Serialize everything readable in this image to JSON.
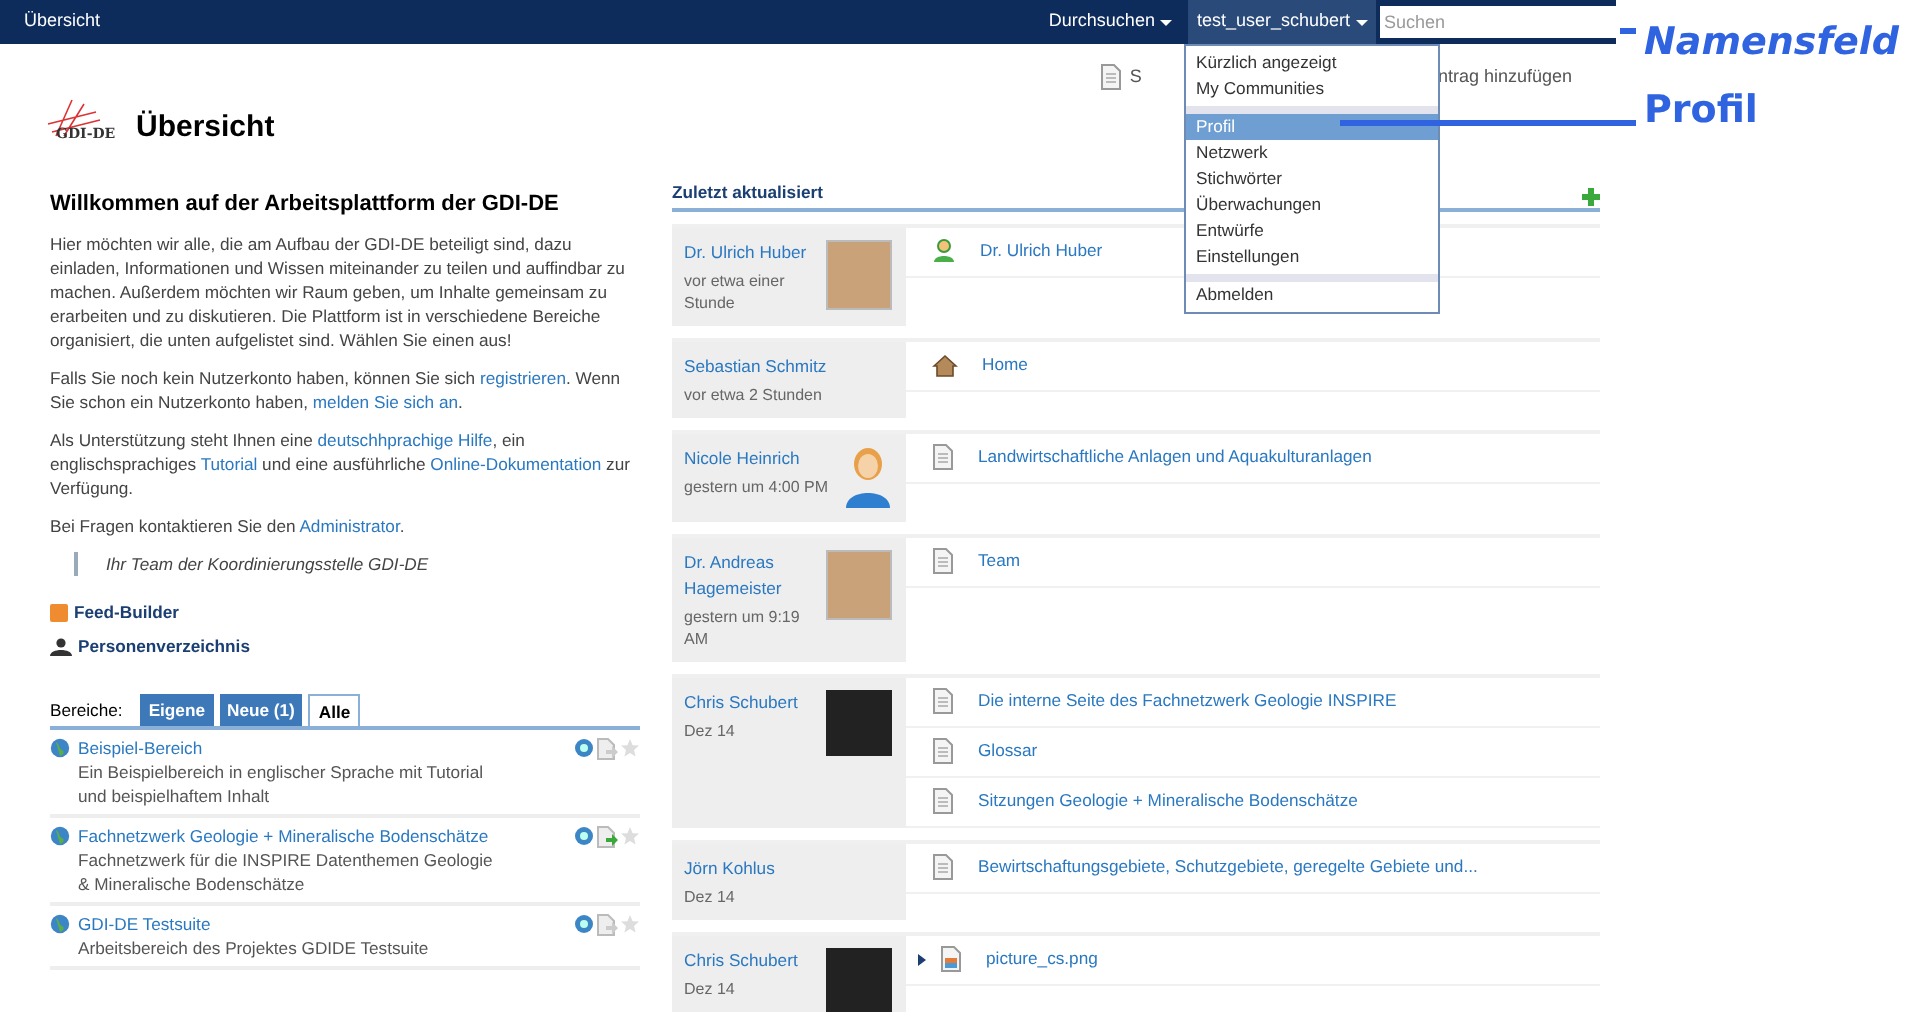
{
  "topbar": {
    "title": "Übersicht",
    "browse": "Durchsuchen",
    "user": "test_user_schubert",
    "search": {
      "placeholder": "Suchen"
    }
  },
  "user_menu": {
    "items": [
      {
        "label": "Kürzlich angezeigt",
        "selected": false,
        "divider_before": false
      },
      {
        "label": "My Communities",
        "selected": false,
        "divider_before": false
      },
      {
        "label": "Profil",
        "selected": true,
        "divider_before": true
      },
      {
        "label": "Netzwerk",
        "selected": false,
        "divider_before": false
      },
      {
        "label": "Stichwörter",
        "selected": false,
        "divider_before": false
      },
      {
        "label": "Überwachungen",
        "selected": false,
        "divider_before": false
      },
      {
        "label": "Entwürfe",
        "selected": false,
        "divider_before": false
      },
      {
        "label": "Einstellungen",
        "selected": false,
        "divider_before": false
      },
      {
        "label": "Abmelden",
        "selected": false,
        "divider_before": true
      }
    ]
  },
  "header": {
    "logo_text": "GDI-DE",
    "title": "Übersicht",
    "action_left": "S",
    "action_right": "ntrag hinzufügen"
  },
  "welcome": {
    "heading": "Willkommen auf der Arbeitsplattform der GDI-DE",
    "paragraphs": [
      [
        {
          "kind": "text",
          "text": "Hier möchten wir alle, die am Aufbau der GDI-DE beteiligt sind, dazu einladen, Informationen und Wissen miteinander zu teilen und auffindbar zu machen. Außerdem möchten wir Raum geben, um Inhalte gemeinsam zu erarbeiten und zu diskutieren. Die Plattform ist in verschiedene Bereiche organisiert, die unten aufgelistet sind. Wählen Sie einen aus!"
        }
      ],
      [
        {
          "kind": "text",
          "text": "Falls Sie noch kein Nutzerkonto haben, können Sie sich "
        },
        {
          "kind": "link",
          "text": "registrieren"
        },
        {
          "kind": "text",
          "text": ". Wenn Sie schon ein Nutzerkonto haben, "
        },
        {
          "kind": "link",
          "text": "melden Sie sich an"
        },
        {
          "kind": "text",
          "text": "."
        }
      ],
      [
        {
          "kind": "text",
          "text": "Als Unterstützung steht Ihnen eine "
        },
        {
          "kind": "link",
          "text": "deutschhprachige Hilfe"
        },
        {
          "kind": "text",
          "text": ", ein englischsprachiges "
        },
        {
          "kind": "link",
          "text": "Tutorial"
        },
        {
          "kind": "text",
          "text": " und eine ausführliche "
        },
        {
          "kind": "link",
          "text": "Online-Dokumentation"
        },
        {
          "kind": "text",
          "text": " zur Verfügung."
        }
      ],
      [
        {
          "kind": "text",
          "text": "Bei Fragen kontaktieren Sie den "
        },
        {
          "kind": "link",
          "text": "Administrator"
        },
        {
          "kind": "text",
          "text": "."
        }
      ]
    ],
    "signature": "Ihr Team der Koordinierungsstelle GDI-DE"
  },
  "links": [
    {
      "kind": "feed",
      "label": "Feed-Builder"
    },
    {
      "kind": "people",
      "label": "Personenverzeichnis"
    }
  ],
  "areas": {
    "label": "Bereiche:",
    "tabs": [
      {
        "label": "Eigene",
        "selected": false
      },
      {
        "label": "Neue (1)",
        "selected": false
      },
      {
        "label": "Alle",
        "selected": true
      }
    ],
    "items": [
      {
        "title": "Beispiel-Bereich",
        "description": "Ein Beispielbereich in englischer Sprache mit Tutorial und beispielhaftem Inhalt",
        "subscribed": false
      },
      {
        "title": "Fachnetzwerk Geologie + Mineralische Bodenschätze",
        "description": "Fachnetzwerk für die INSPIRE Datenthemen Geologie & Mineralische Bodenschätze",
        "subscribed": true
      },
      {
        "title": "GDI-DE Testsuite",
        "description": "Arbeitsbereich des Projektes GDIDE Testsuite",
        "subscribed": false
      }
    ]
  },
  "recent": {
    "heading": "Zuletzt aktualisiert",
    "rows": [
      {
        "name": "Dr. Ulrich Huber",
        "time": "vor etwa einer Stunde",
        "avatar": {
          "kind": "photo"
        },
        "entries": [
          {
            "kind": "person",
            "title": "Dr. Ulrich Huber",
            "expandable": false
          }
        ]
      },
      {
        "name": "Sebastian Schmitz",
        "time": "vor etwa 2 Stunden",
        "entries": [
          {
            "kind": "home",
            "title": "Home",
            "expandable": false
          }
        ]
      },
      {
        "name": "Nicole Heinrich",
        "time": "gestern um 4:00 PM",
        "avatar": {
          "kind": "silhouette"
        },
        "entries": [
          {
            "kind": "page",
            "title": "Landwirtschaftliche Anlagen und Aquakulturanlagen",
            "expandable": false
          }
        ]
      },
      {
        "name": "Dr. Andreas Hagemeister",
        "time": "gestern um 9:19 AM",
        "avatar": {
          "kind": "photo"
        },
        "entries": [
          {
            "kind": "page",
            "title": "Team",
            "expandable": false
          }
        ]
      },
      {
        "name": "Chris Schubert",
        "time": "Dez 14",
        "avatar": {
          "kind": "photo_dark"
        },
        "entries": [
          {
            "kind": "page",
            "title": "Die interne Seite des Fachnetzwerk Geologie INSPIRE",
            "expandable": false
          },
          {
            "kind": "page",
            "title": "Glossar",
            "expandable": false
          },
          {
            "kind": "page",
            "title": "Sitzungen Geologie + Mineralische Bodenschätze",
            "expandable": false
          }
        ]
      },
      {
        "name": "Jörn Kohlus",
        "time": "Dez 14",
        "entries": [
          {
            "kind": "page",
            "title": "Bewirtschaftungsgebiete, Schutzgebiete, geregelte Gebiete und...",
            "expandable": false
          }
        ]
      },
      {
        "name": "Chris Schubert",
        "time": "Dez 14",
        "avatar": {
          "kind": "photo_dark"
        },
        "entries": [
          {
            "kind": "image",
            "title": "picture_cs.png",
            "expandable": true
          }
        ]
      }
    ]
  },
  "annotations": [
    {
      "label": "Namensfeld",
      "italic": true
    },
    {
      "label": "Profil",
      "italic": false
    }
  ]
}
